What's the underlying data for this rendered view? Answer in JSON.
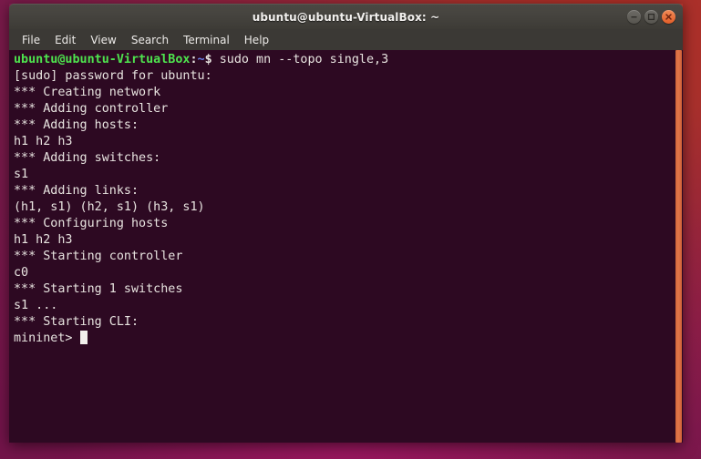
{
  "window": {
    "title": "ubuntu@ubuntu-VirtualBox: ~",
    "controls": {
      "minimize_label": "Minimize",
      "maximize_label": "Maximize",
      "close_label": "Close"
    }
  },
  "menubar": {
    "items": [
      {
        "label": "File"
      },
      {
        "label": "Edit"
      },
      {
        "label": "View"
      },
      {
        "label": "Search"
      },
      {
        "label": "Terminal"
      },
      {
        "label": "Help"
      }
    ]
  },
  "terminal": {
    "prompt": {
      "user_host": "ubuntu@ubuntu-VirtualBox",
      "colon": ":",
      "path": "~",
      "dollar": "$",
      "command": " sudo mn --topo single,3"
    },
    "lines": [
      "[sudo] password for ubuntu:",
      "*** Creating network",
      "*** Adding controller",
      "*** Adding hosts:",
      "h1 h2 h3",
      "*** Adding switches:",
      "s1",
      "*** Adding links:",
      "(h1, s1) (h2, s1) (h3, s1)",
      "*** Configuring hosts",
      "h1 h2 h3",
      "*** Starting controller",
      "c0",
      "*** Starting 1 switches",
      "s1 ...",
      "*** Starting CLI:"
    ],
    "mininet_prompt": "mininet> ",
    "cursor": "block"
  },
  "colors": {
    "terminal_bg": "#2d0922",
    "terminal_fg": "#e8e4e0",
    "prompt_user": "#4ee24e",
    "prompt_path": "#6a7fe8",
    "titlebar_bg": "#3d3b36",
    "menubar_bg": "#3b3935",
    "close_button": "#e35d28",
    "scrollbar": "#d4673a",
    "desktop_bg": "#a42f2a"
  }
}
